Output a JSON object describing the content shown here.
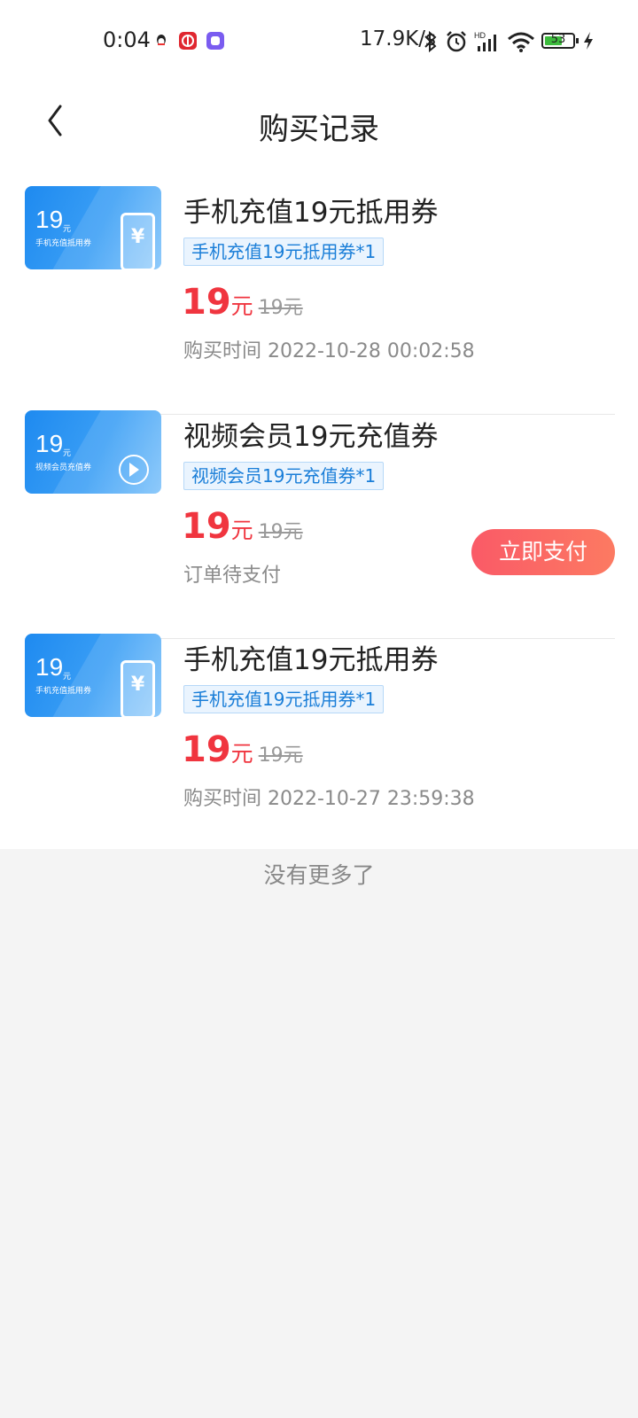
{
  "status_bar": {
    "time": "0:04",
    "net_speed": "17.9K/s",
    "battery": "53",
    "icons": [
      "qq-icon",
      "app-red-icon",
      "app-purple-icon",
      "bluetooth-icon",
      "alarm-icon",
      "signal-icon",
      "wifi-icon",
      "battery-icon",
      "charging-icon"
    ]
  },
  "header": {
    "title": "购买记录"
  },
  "orders": [
    {
      "thumb_num": "19",
      "thumb_unit": "元",
      "thumb_sub": "手机充值抵用券",
      "thumb_icon": "phone-yen-icon",
      "title": "手机充值19元抵用券",
      "tag": "手机充值19元抵用券*1",
      "price": "19",
      "unit": "元",
      "orig_price": "19元",
      "meta": "购买时间 2022-10-28 00:02:58"
    },
    {
      "thumb_num": "19",
      "thumb_unit": "元",
      "thumb_sub": "视频会员充值券",
      "thumb_icon": "play-icon",
      "title": "视频会员19元充值券",
      "tag": "视频会员19元充值券*1",
      "price": "19",
      "unit": "元",
      "orig_price": "19元",
      "meta": "订单待支付",
      "action": "立即支付"
    },
    {
      "thumb_num": "19",
      "thumb_unit": "元",
      "thumb_sub": "手机充值抵用券",
      "thumb_icon": "phone-yen-icon",
      "title": "手机充值19元抵用券",
      "tag": "手机充值19元抵用券*1",
      "price": "19",
      "unit": "元",
      "orig_price": "19元",
      "meta": "购买时间 2022-10-27 23:59:38"
    }
  ],
  "footer": {
    "no_more": "没有更多了"
  },
  "colors": {
    "price_red": "#f0353f",
    "tag_blue": "#1a7ed8",
    "pay_button": "#fa5a67"
  }
}
